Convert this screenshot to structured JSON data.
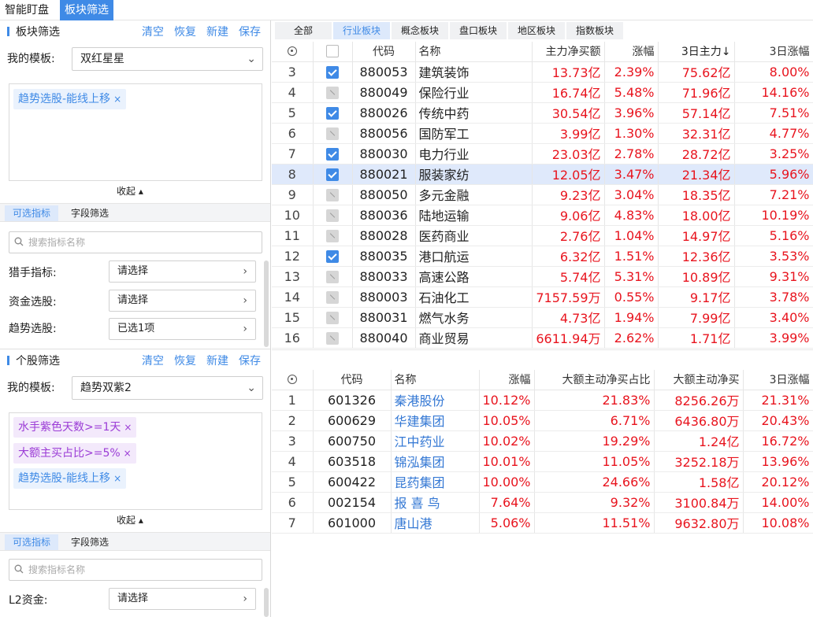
{
  "top_tabs": [
    {
      "label": "智能盯盘",
      "active": false
    },
    {
      "label": "板块筛选",
      "active": true
    }
  ],
  "sector_filter": {
    "title": "板块筛选",
    "actions": [
      "清空",
      "恢复",
      "新建",
      "保存"
    ],
    "template_label": "我的模板:",
    "template_value": "双红星星",
    "tags": [
      {
        "text": "趋势选股-能线上移",
        "color": "blue"
      }
    ],
    "collapse_label": "收起",
    "subtabs": [
      {
        "label": "可选指标",
        "active": true
      },
      {
        "label": "字段筛选",
        "active": false
      }
    ],
    "search_placeholder": "搜索指标名称",
    "pickers": [
      {
        "label": "猎手指标:",
        "value": "请选择"
      },
      {
        "label": "资金选股:",
        "value": "请选择"
      },
      {
        "label": "趋势选股:",
        "value": "已选1项"
      }
    ]
  },
  "stock_filter": {
    "title": "个股筛选",
    "actions": [
      "清空",
      "恢复",
      "新建",
      "保存"
    ],
    "template_label": "我的模板:",
    "template_value": "趋势双紫2",
    "tags": [
      {
        "text": "水手紫色天数>=1天",
        "color": "purple"
      },
      {
        "text": "大额主买占比>=5%",
        "color": "purple"
      },
      {
        "text": "趋势选股-能线上移",
        "color": "blue"
      }
    ],
    "collapse_label": "收起",
    "subtabs": [
      {
        "label": "可选指标",
        "active": true
      },
      {
        "label": "字段筛选",
        "active": false
      }
    ],
    "search_placeholder": "搜索指标名称",
    "pickers": [
      {
        "label": "L2资金:",
        "value": "请选择"
      }
    ]
  },
  "panel_tabs": [
    {
      "label": "全部",
      "active": false
    },
    {
      "label": "行业板块",
      "active": true
    },
    {
      "label": "概念板块",
      "active": false
    },
    {
      "label": "盘口板块",
      "active": false
    },
    {
      "label": "地区板块",
      "active": false
    },
    {
      "label": "指数板块",
      "active": false
    }
  ],
  "sector_table": {
    "headers": [
      "",
      "",
      "代码",
      "名称",
      "主力净买额",
      "涨幅",
      "3日主力↓",
      "3日涨幅"
    ],
    "rows": [
      {
        "idx": "3",
        "check": "on",
        "code": "880053",
        "name": "建筑装饰",
        "net": "13.73亿",
        "chg": "2.39%",
        "main3": "75.62亿",
        "chg3": "8.00%",
        "sel": false
      },
      {
        "idx": "4",
        "check": "dis",
        "code": "880049",
        "name": "保险行业",
        "net": "16.74亿",
        "chg": "5.48%",
        "main3": "71.96亿",
        "chg3": "14.16%",
        "sel": false
      },
      {
        "idx": "5",
        "check": "on",
        "code": "880026",
        "name": "传统中药",
        "net": "30.54亿",
        "chg": "3.96%",
        "main3": "57.14亿",
        "chg3": "7.51%",
        "sel": false
      },
      {
        "idx": "6",
        "check": "dis",
        "code": "880056",
        "name": "国防军工",
        "net": "3.99亿",
        "chg": "1.30%",
        "main3": "32.31亿",
        "chg3": "4.77%",
        "sel": false
      },
      {
        "idx": "7",
        "check": "on",
        "code": "880030",
        "name": "电力行业",
        "net": "23.03亿",
        "chg": "2.78%",
        "main3": "28.72亿",
        "chg3": "3.25%",
        "sel": false
      },
      {
        "idx": "8",
        "check": "on",
        "code": "880021",
        "name": "服装家纺",
        "net": "12.05亿",
        "chg": "3.47%",
        "main3": "21.34亿",
        "chg3": "5.96%",
        "sel": true
      },
      {
        "idx": "9",
        "check": "dis",
        "code": "880050",
        "name": "多元金融",
        "net": "9.23亿",
        "chg": "3.04%",
        "main3": "18.35亿",
        "chg3": "7.21%",
        "sel": false
      },
      {
        "idx": "10",
        "check": "dis",
        "code": "880036",
        "name": "陆地运输",
        "net": "9.06亿",
        "chg": "4.83%",
        "main3": "18.00亿",
        "chg3": "10.19%",
        "sel": false
      },
      {
        "idx": "11",
        "check": "dis",
        "code": "880028",
        "name": "医药商业",
        "net": "2.76亿",
        "chg": "1.04%",
        "main3": "14.97亿",
        "chg3": "5.16%",
        "sel": false
      },
      {
        "idx": "12",
        "check": "on",
        "code": "880035",
        "name": "港口航运",
        "net": "6.32亿",
        "chg": "1.51%",
        "main3": "12.36亿",
        "chg3": "3.53%",
        "sel": false
      },
      {
        "idx": "13",
        "check": "dis",
        "code": "880033",
        "name": "高速公路",
        "net": "5.74亿",
        "chg": "5.31%",
        "main3": "10.89亿",
        "chg3": "9.31%",
        "sel": false
      },
      {
        "idx": "14",
        "check": "dis",
        "code": "880003",
        "name": "石油化工",
        "net": "7157.59万",
        "chg": "0.55%",
        "main3": "9.17亿",
        "chg3": "3.78%",
        "sel": false
      },
      {
        "idx": "15",
        "check": "dis",
        "code": "880031",
        "name": "燃气水务",
        "net": "4.73亿",
        "chg": "1.94%",
        "main3": "7.99亿",
        "chg3": "3.40%",
        "sel": false
      },
      {
        "idx": "16",
        "check": "dis",
        "code": "880040",
        "name": "商业贸易",
        "net": "6611.94万",
        "chg": "2.62%",
        "main3": "1.71亿",
        "chg3": "3.99%",
        "sel": false
      }
    ]
  },
  "stock_table": {
    "headers": [
      "",
      "代码",
      "名称",
      "涨幅",
      "大额主动净买占比",
      "大额主动净买",
      "3日涨幅"
    ],
    "rows": [
      {
        "idx": "1",
        "code": "601326",
        "name": "秦港股份",
        "chg": "10.12%",
        "ratio": "21.83%",
        "net": "8256.26万",
        "chg3": "21.31%"
      },
      {
        "idx": "2",
        "code": "600629",
        "name": "华建集团",
        "chg": "10.05%",
        "ratio": "6.71%",
        "net": "6436.80万",
        "chg3": "20.43%"
      },
      {
        "idx": "3",
        "code": "600750",
        "name": "江中药业",
        "chg": "10.02%",
        "ratio": "19.29%",
        "net": "1.24亿",
        "chg3": "16.72%"
      },
      {
        "idx": "4",
        "code": "603518",
        "name": "锦泓集团",
        "chg": "10.01%",
        "ratio": "11.05%",
        "net": "3252.18万",
        "chg3": "13.96%"
      },
      {
        "idx": "5",
        "code": "600422",
        "name": "昆药集团",
        "chg": "10.00%",
        "ratio": "24.66%",
        "net": "1.58亿",
        "chg3": "20.12%"
      },
      {
        "idx": "6",
        "code": "002154",
        "name": "报 喜 鸟",
        "chg": "7.64%",
        "ratio": "9.32%",
        "net": "3100.84万",
        "chg3": "14.00%"
      },
      {
        "idx": "7",
        "code": "601000",
        "name": "唐山港",
        "chg": "5.06%",
        "ratio": "11.51%",
        "net": "9632.80万",
        "chg3": "10.08%"
      }
    ]
  },
  "colors": {
    "accent": "#3f8ae6",
    "up": "#e8141e",
    "link": "#3478d4",
    "selected_row": "#dfe9fb",
    "tag_purple": "#9b3cd6"
  }
}
